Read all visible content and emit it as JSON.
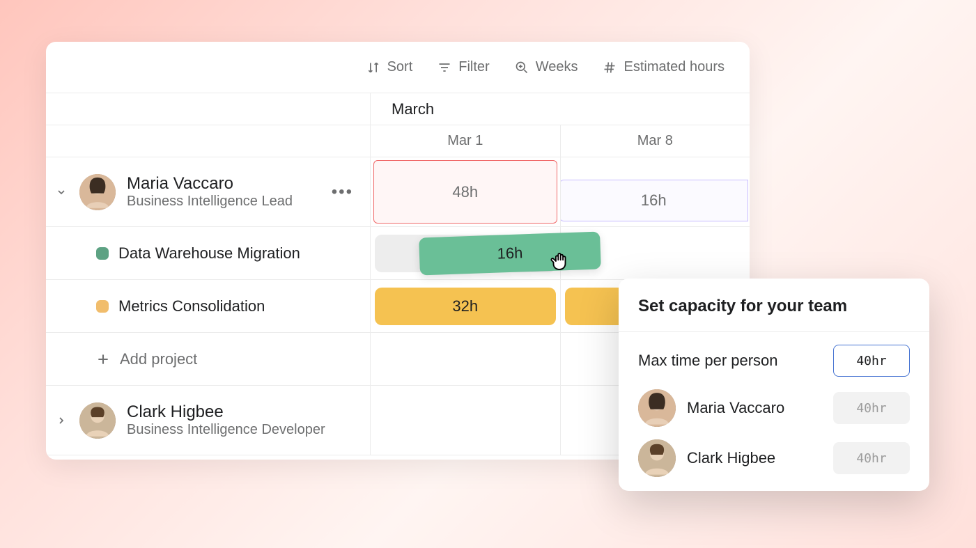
{
  "toolbar": {
    "sort": "Sort",
    "filter": "Filter",
    "weeks": "Weeks",
    "estimated": "Estimated hours"
  },
  "timeline": {
    "month": "March",
    "weeks": [
      "Mar 1",
      "Mar 8"
    ]
  },
  "people": [
    {
      "name": "Maria Vaccaro",
      "role": "Business Intelligence Lead",
      "capacity": [
        "48h",
        "16h"
      ],
      "projects": [
        {
          "name": "Data Warehouse Migration",
          "color": "green",
          "hours": "16h"
        },
        {
          "name": "Metrics Consolidation",
          "color": "amber",
          "hours": "32h"
        }
      ]
    },
    {
      "name": "Clark Higbee",
      "role": "Business Intelligence Developer"
    }
  ],
  "add_project": "Add project",
  "popover": {
    "title": "Set capacity for your team",
    "max_label": "Max time per person",
    "max_value": "40hr",
    "members": [
      {
        "name": "Maria Vaccaro",
        "value": "40hr"
      },
      {
        "name": "Clark Higbee",
        "value": "40hr"
      }
    ]
  }
}
